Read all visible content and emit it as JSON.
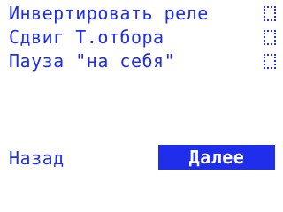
{
  "options": [
    {
      "label": "Инвертировать реле",
      "checked": false
    },
    {
      "label": "Сдвиг Т.отбора",
      "checked": false
    },
    {
      "label": "Пауза \"на себя\"",
      "checked": false
    }
  ],
  "nav": {
    "back_label": "Назад",
    "next_label": "Далее"
  },
  "colors": {
    "accent": "#1f2eea",
    "background": "#ffffff"
  }
}
